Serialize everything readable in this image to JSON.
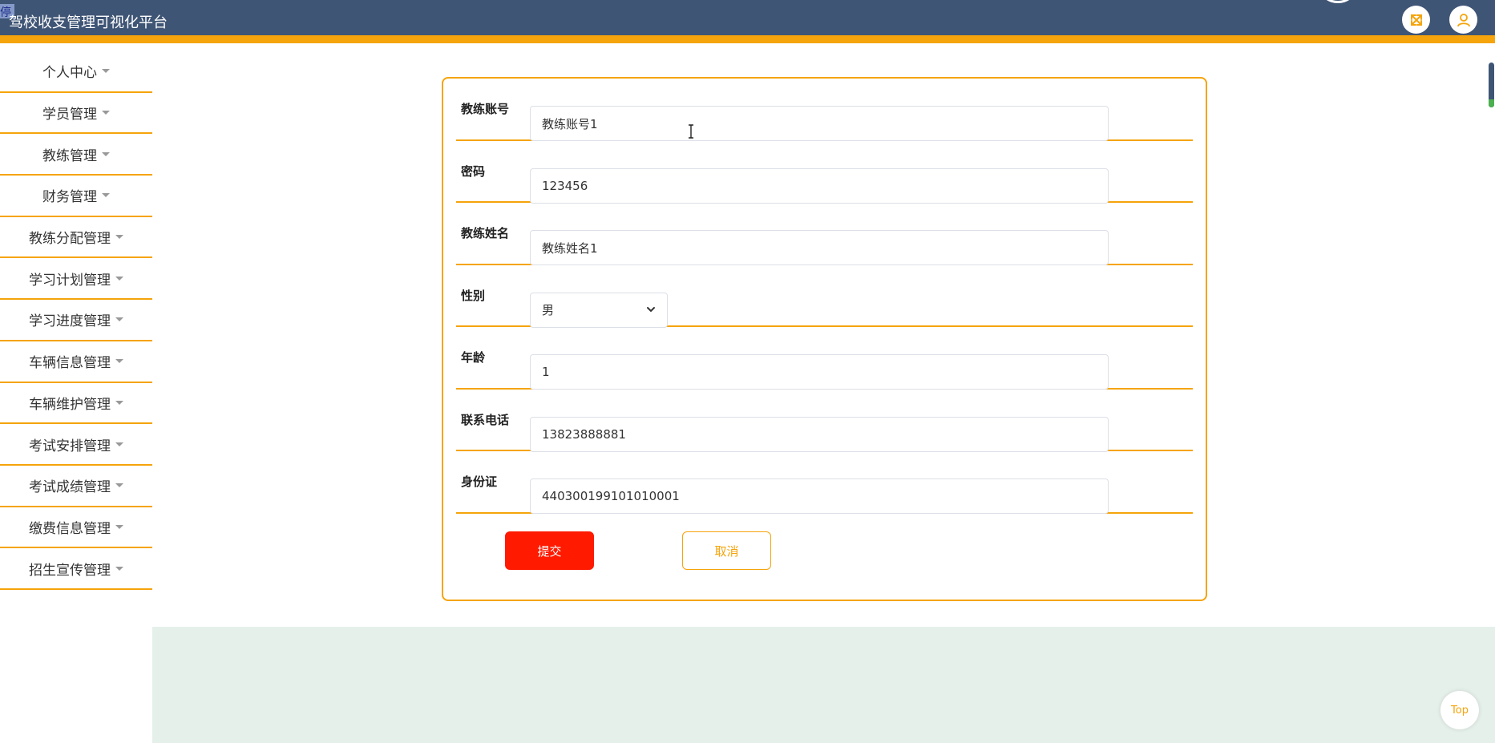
{
  "header": {
    "title": "驾校收支管理可视化平台",
    "corner_glyph": "停",
    "fullscreen_icon": "expand-arrows-icon",
    "user_icon": "user-icon"
  },
  "colors": {
    "header_bg": "#3f5575",
    "accent": "#f5a40b",
    "submit": "#ff1a00",
    "band": "#e6f0eb"
  },
  "sidebar": {
    "items": [
      {
        "label": "个人中心"
      },
      {
        "label": "学员管理"
      },
      {
        "label": "教练管理"
      },
      {
        "label": "财务管理"
      },
      {
        "label": "教练分配管理"
      },
      {
        "label": "学习计划管理"
      },
      {
        "label": "学习进度管理"
      },
      {
        "label": "车辆信息管理"
      },
      {
        "label": "车辆维护管理"
      },
      {
        "label": "考试安排管理"
      },
      {
        "label": "考试成绩管理"
      },
      {
        "label": "缴费信息管理"
      },
      {
        "label": "招生宣传管理"
      }
    ]
  },
  "form": {
    "fields": [
      {
        "label": "教练账号",
        "value": "教练账号1"
      },
      {
        "label": "密码",
        "value": "123456"
      },
      {
        "label": "教练姓名",
        "value": "教练姓名1"
      },
      {
        "label": "性别",
        "value": "男"
      },
      {
        "label": "年龄",
        "value": "1"
      },
      {
        "label": "联系电话",
        "value": "13823888881"
      },
      {
        "label": "身份证",
        "value": "440300199101010001"
      }
    ],
    "submit_label": "提交",
    "cancel_label": "取消"
  },
  "back_to_top": "Top"
}
